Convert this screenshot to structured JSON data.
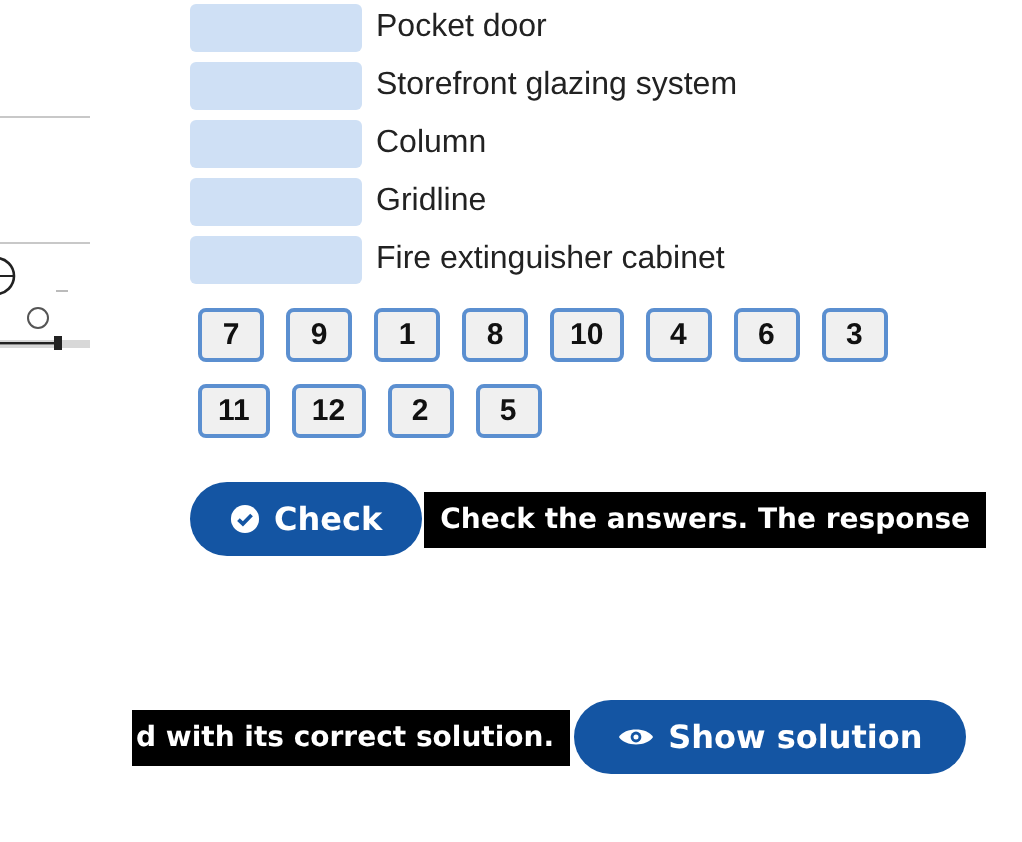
{
  "picture": {
    "kind": "picture"
  },
  "items": [
    {
      "label": "Pocket door"
    },
    {
      "label": "Storefront glazing system"
    },
    {
      "label": "Column"
    },
    {
      "label": "Gridline"
    },
    {
      "label": "Fire extinguisher cabinet"
    }
  ],
  "tile_rows": [
    [
      "7",
      "9",
      "1",
      "8",
      "10",
      "4",
      "6",
      "3"
    ],
    [
      "11",
      "12",
      "2",
      "5"
    ]
  ],
  "check": {
    "label": "Check",
    "tooltip": "Check the answers. The response"
  },
  "show_solution": {
    "label": "Show solution",
    "tooltip": "d with its correct solution."
  }
}
